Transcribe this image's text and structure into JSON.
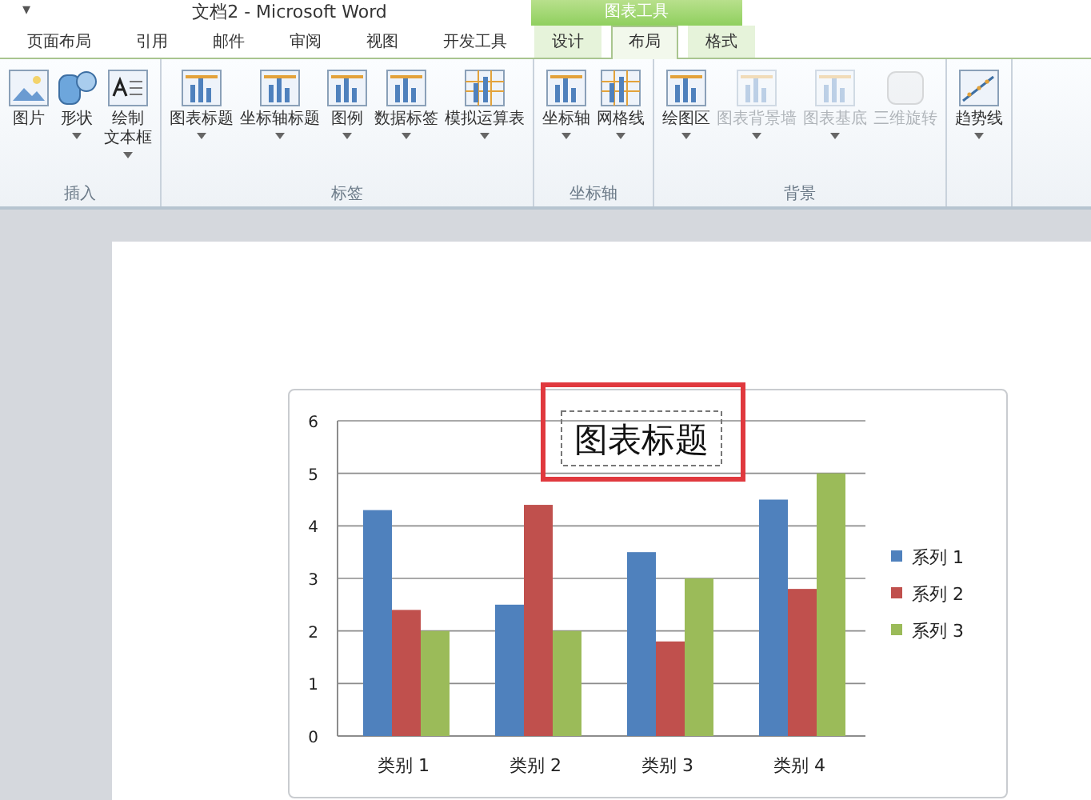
{
  "window": {
    "title": "文档2 - Microsoft Word",
    "quick_access": "▾"
  },
  "context_tab_group": "图表工具",
  "tabs": [
    {
      "label": "页面布局",
      "selected": false,
      "contextual": false
    },
    {
      "label": "引用",
      "selected": false,
      "contextual": false
    },
    {
      "label": "邮件",
      "selected": false,
      "contextual": false
    },
    {
      "label": "审阅",
      "selected": false,
      "contextual": false
    },
    {
      "label": "视图",
      "selected": false,
      "contextual": false
    },
    {
      "label": "开发工具",
      "selected": false,
      "contextual": false
    },
    {
      "label": "设计",
      "selected": false,
      "contextual": true
    },
    {
      "label": "布局",
      "selected": true,
      "contextual": true
    },
    {
      "label": "格式",
      "selected": false,
      "contextual": true
    }
  ],
  "ribbon": {
    "groups": [
      {
        "label": "插入",
        "buttons": [
          {
            "label": "图片",
            "kind": "picture",
            "menu": false,
            "disabled": false
          },
          {
            "label": "形状",
            "kind": "shapes",
            "menu": true,
            "disabled": false
          },
          {
            "label": "绘制",
            "label_line_2": "文本框",
            "kind": "textbox",
            "menu": true,
            "disabled": false
          }
        ]
      },
      {
        "label": "标签",
        "buttons": [
          {
            "label": "图表标题",
            "kind": "chart",
            "menu": true,
            "disabled": false
          },
          {
            "label": "坐标轴标题",
            "kind": "chart",
            "menu": true,
            "disabled": false
          },
          {
            "label": "图例",
            "kind": "chart",
            "menu": true,
            "disabled": false
          },
          {
            "label": "数据标签",
            "kind": "chart",
            "menu": true,
            "disabled": false
          },
          {
            "label": "模拟运算表",
            "kind": "grid",
            "menu": true,
            "disabled": false
          }
        ]
      },
      {
        "label": "坐标轴",
        "buttons": [
          {
            "label": "坐标轴",
            "kind": "chart",
            "menu": true,
            "disabled": false
          },
          {
            "label": "网格线",
            "kind": "grid",
            "menu": true,
            "disabled": false
          }
        ]
      },
      {
        "label": "背景",
        "buttons": [
          {
            "label": "绘图区",
            "kind": "chart",
            "menu": true,
            "disabled": false
          },
          {
            "label": "图表背景墙",
            "kind": "chart",
            "menu": true,
            "disabled": true
          },
          {
            "label": "图表基底",
            "kind": "chart",
            "menu": true,
            "disabled": true
          },
          {
            "label": "三维旋转",
            "kind": "cube",
            "menu": false,
            "disabled": true
          }
        ]
      },
      {
        "buttons": [
          {
            "label": "趋势线",
            "kind": "trend",
            "menu": true,
            "disabled": false
          }
        ]
      }
    ]
  },
  "chart": {
    "title_selected": true,
    "highlighted": true,
    "chart_data": {
      "type": "bar",
      "title": "图表标题",
      "categories": [
        "类别 1",
        "类别 2",
        "类别 3",
        "类别 4"
      ],
      "series": [
        {
          "name": "系列 1",
          "color": "#4f81bd",
          "values": [
            4.3,
            2.5,
            3.5,
            4.5
          ]
        },
        {
          "name": "系列 2",
          "color": "#c0504d",
          "values": [
            2.4,
            4.4,
            1.8,
            2.8
          ]
        },
        {
          "name": "系列 3",
          "color": "#9bbb59",
          "values": [
            2,
            2,
            3,
            5
          ]
        }
      ],
      "ylim": [
        0,
        6
      ],
      "yticks": [
        0,
        1,
        2,
        3,
        4,
        5,
        6
      ],
      "grid": true,
      "legend": true
    }
  }
}
